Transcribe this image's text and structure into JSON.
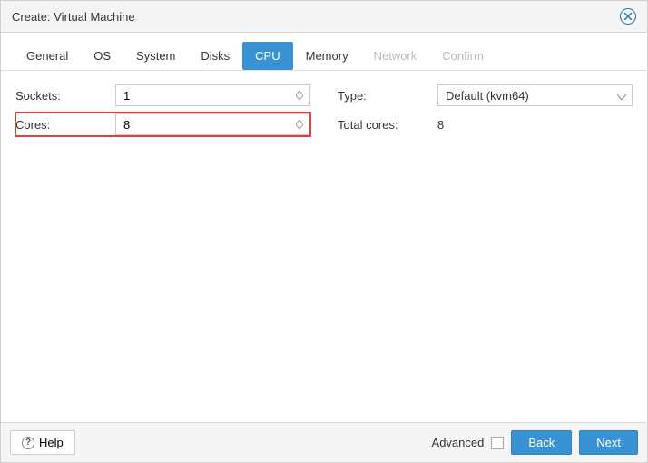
{
  "header": {
    "title": "Create: Virtual Machine"
  },
  "tabs": {
    "general": "General",
    "os": "OS",
    "system": "System",
    "disks": "Disks",
    "cpu": "CPU",
    "memory": "Memory",
    "network": "Network",
    "confirm": "Confirm"
  },
  "cpu": {
    "sockets_label": "Sockets:",
    "sockets_value": "1",
    "cores_label": "Cores:",
    "cores_value": "8",
    "type_label": "Type:",
    "type_value": "Default (kvm64)",
    "total_cores_label": "Total cores:",
    "total_cores_value": "8"
  },
  "footer": {
    "help": "Help",
    "advanced": "Advanced",
    "back": "Back",
    "next": "Next"
  }
}
